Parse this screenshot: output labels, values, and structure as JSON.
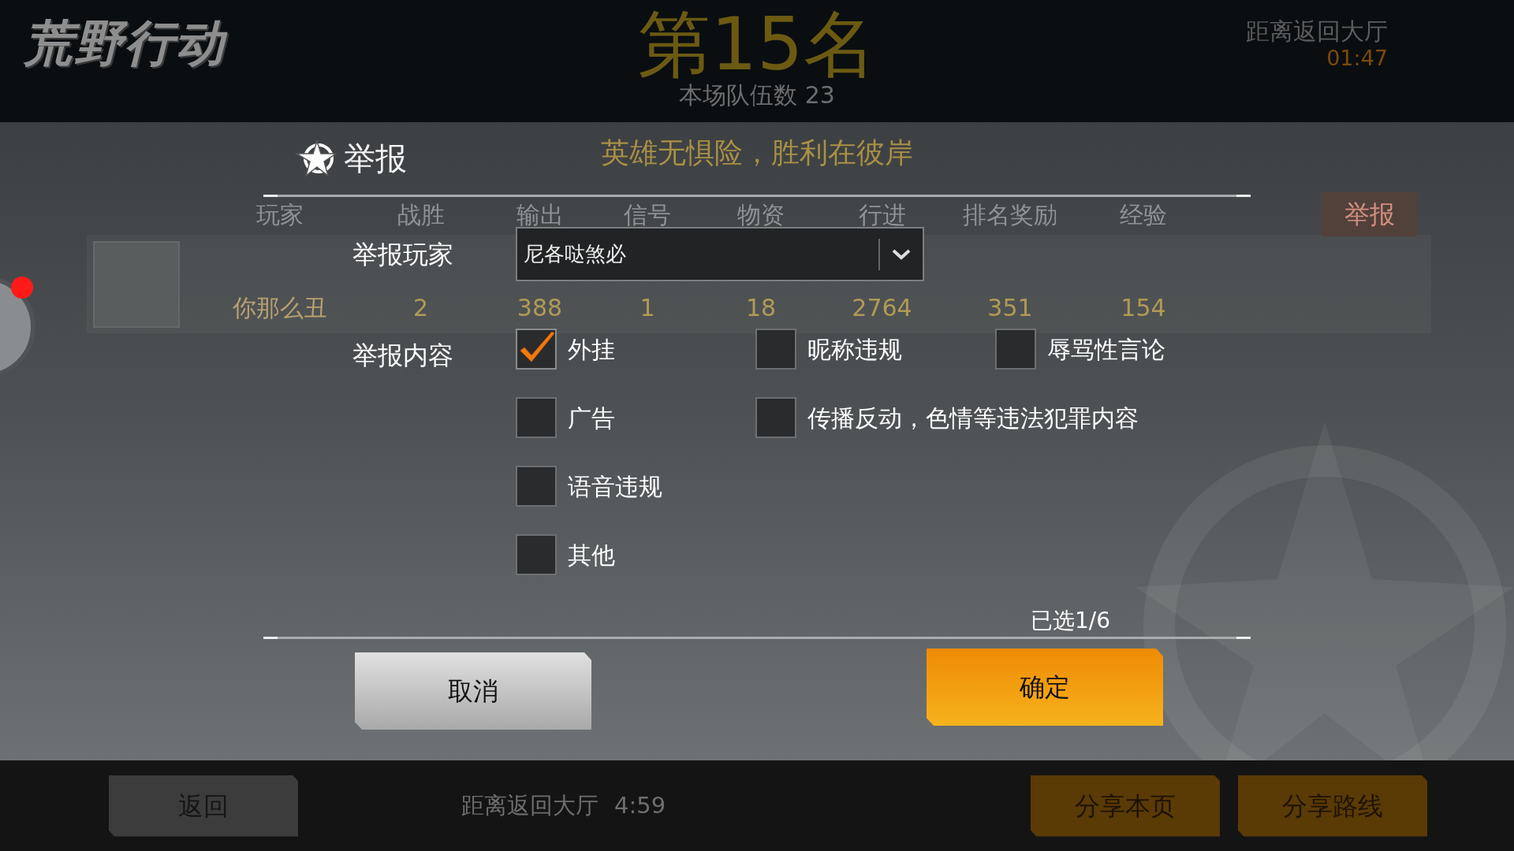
{
  "header": {
    "logo": "荒野行动",
    "rank": "第15名",
    "team_count": "本场队伍数 23",
    "countdown_label": "距离返回大厅",
    "countdown": "01:47"
  },
  "background": {
    "slogan": "英雄无惧险，胜利在彼岸",
    "columns": [
      "玩家",
      "战胜",
      "输出",
      "信号",
      "物资",
      "行进",
      "排名奖励",
      "经验"
    ],
    "report_button": "举报",
    "row": {
      "name": "你那么丑",
      "cells": [
        "2",
        "388",
        "1",
        "18",
        "2764",
        "351",
        "154"
      ]
    }
  },
  "dialog": {
    "title": "举报",
    "player_label": "举报玩家",
    "player_value": "尼各哒煞必",
    "content_label": "举报内容",
    "option_rows": [
      [
        {
          "label": "外挂",
          "checked": true
        },
        {
          "label": "昵称违规",
          "checked": false
        },
        {
          "label": "辱骂性言论",
          "checked": false
        }
      ],
      [
        {
          "label": "广告",
          "checked": false
        },
        {
          "label": "传播反动，色情等违法犯罪内容",
          "checked": false
        }
      ],
      [
        {
          "label": "语音违规",
          "checked": false
        }
      ],
      [
        {
          "label": "其他",
          "checked": false
        }
      ]
    ],
    "selected_count": "已选1/6",
    "cancel": "取消",
    "confirm": "确定"
  },
  "footer": {
    "back": "返回",
    "countdown_label": "距离返回大厅",
    "countdown": "4:59",
    "share_page": "分享本页",
    "share_route": "分享路线"
  }
}
